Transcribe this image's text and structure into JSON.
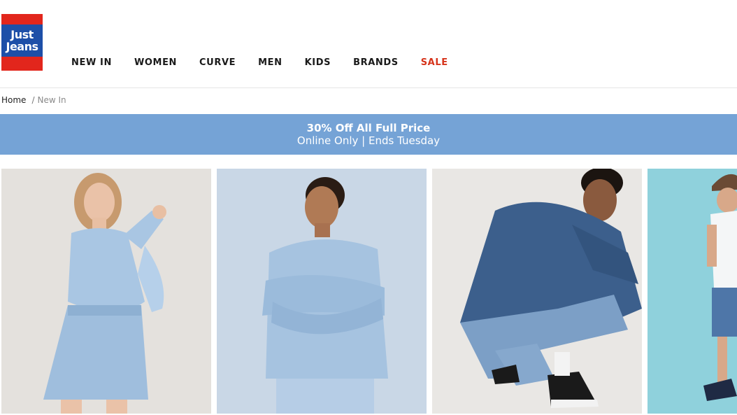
{
  "brand": {
    "logo_line1": "Just",
    "logo_line2": "Jeans",
    "colors": {
      "red": "#e2261c",
      "blue": "#1d4fa8"
    }
  },
  "nav": {
    "items": [
      {
        "label": "NEW IN"
      },
      {
        "label": "WOMEN"
      },
      {
        "label": "CURVE"
      },
      {
        "label": "MEN"
      },
      {
        "label": "KIDS"
      },
      {
        "label": "BRANDS"
      },
      {
        "label": "SALE",
        "color": "#d6331a"
      }
    ]
  },
  "breadcrumb": {
    "home": "Home",
    "separator": "/",
    "current": "New In"
  },
  "promo": {
    "title": "30% Off All Full Price",
    "subtitle": "Online Only | Ends Tuesday",
    "background": "#75a3d6"
  },
  "tiles": [
    {
      "image": "woman-denim-skirt-photo"
    },
    {
      "image": "woman-denim-shirt-photo"
    },
    {
      "image": "man-denim-jacket-photo"
    },
    {
      "image": "boy-cap-photo"
    }
  ]
}
